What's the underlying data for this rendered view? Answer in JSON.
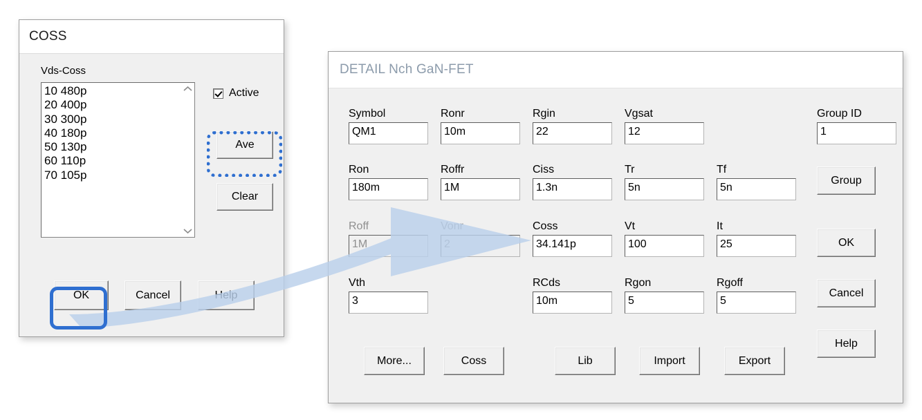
{
  "coss_dialog": {
    "title": "COSS",
    "group_label": "Vds-Coss",
    "list_items": [
      "10 480p",
      "20 400p",
      "30 300p",
      "40 180p",
      "50 130p",
      "60 110p",
      "70 105p"
    ],
    "scroll_up_icon": "chevron-up-icon",
    "scroll_down_icon": "chevron-down-icon",
    "active_checkbox": {
      "label": "Active",
      "checked": true
    },
    "buttons": {
      "ave": "Ave",
      "clear": "Clear",
      "ok": "OK",
      "cancel": "Cancel",
      "help": "Help"
    }
  },
  "detail_dialog": {
    "title": "DETAIL Nch GaN-FET",
    "fields": [
      {
        "label": "Symbol",
        "value": "QM1",
        "dim": false
      },
      {
        "label": "Ronr",
        "value": "10m",
        "dim": false
      },
      {
        "label": "Rgin",
        "value": "22",
        "dim": false
      },
      {
        "label": "Vgsat",
        "value": "12",
        "dim": false
      },
      {
        "label": "Group ID",
        "value": "1",
        "dim": false
      },
      {
        "label": "Ron",
        "value": "180m",
        "dim": false
      },
      {
        "label": "Roffr",
        "value": "1M",
        "dim": false
      },
      {
        "label": "Ciss",
        "value": "1.3n",
        "dim": false
      },
      {
        "label": "Tr",
        "value": "5n",
        "dim": false
      },
      {
        "label": "Tf",
        "value": "5n",
        "dim": false
      },
      {
        "label": "Roff",
        "value": "1M",
        "dim": true
      },
      {
        "label": "Vonr",
        "value": "2",
        "dim": true
      },
      {
        "label": "Coss",
        "value": "34.141p",
        "dim": false
      },
      {
        "label": "Vt",
        "value": "100",
        "dim": false
      },
      {
        "label": "It",
        "value": "25",
        "dim": false
      },
      {
        "label": "Vth",
        "value": "3",
        "dim": false
      },
      {
        "label": "RCds",
        "value": "10m",
        "dim": false
      },
      {
        "label": "Rgon",
        "value": "5",
        "dim": false
      },
      {
        "label": "Rgoff",
        "value": "5",
        "dim": false
      }
    ],
    "bottom_buttons": {
      "more": "More...",
      "coss": "Coss",
      "lib": "Lib",
      "import": "Import",
      "export": "Export"
    },
    "side_buttons": {
      "group": "Group",
      "ok": "OK",
      "cancel": "Cancel",
      "help": "Help"
    }
  },
  "annotations": {
    "highlight_color": "#2f6fd0",
    "arrow_color": "#b9d0ea",
    "ok_highlight_style": "solid",
    "ave_highlight_style": "dotted",
    "arrow_icon": "curved-arrow-icon"
  }
}
